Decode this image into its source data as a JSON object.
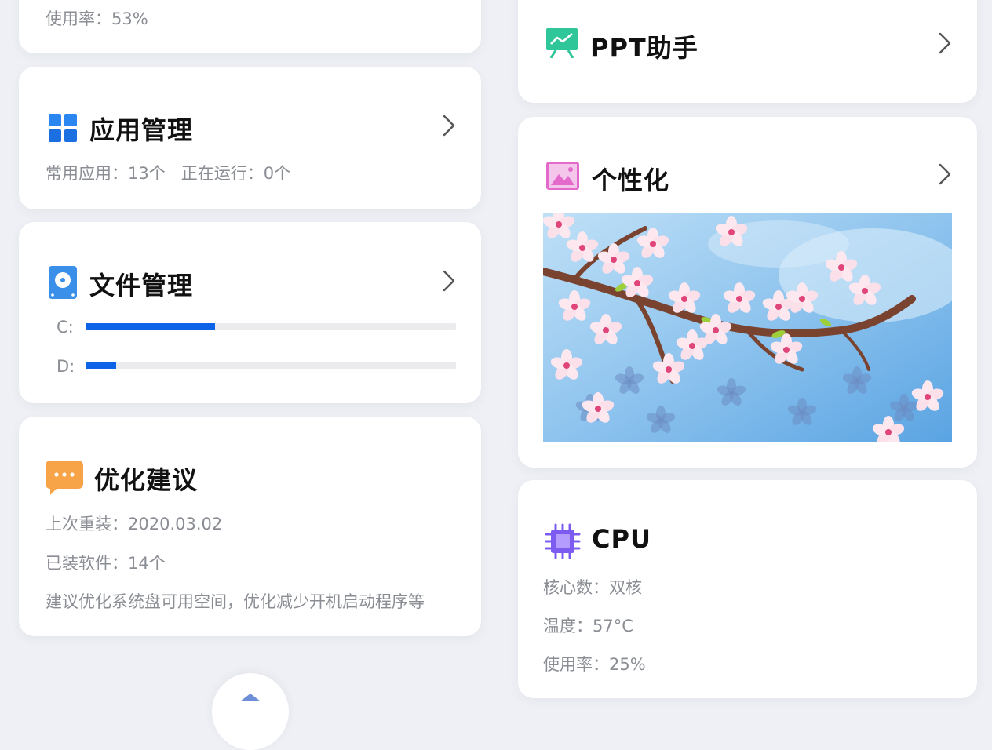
{
  "top_card": {
    "usage": "使用率：53%"
  },
  "app_mgmt": {
    "title": "应用管理",
    "summary": "常用应用：13个   正在运行：0个"
  },
  "file_mgmt": {
    "title": "文件管理",
    "drives": [
      {
        "label": "C:",
        "used_fraction": 0.35
      },
      {
        "label": "D:",
        "used_fraction": 0.083
      }
    ]
  },
  "optimize": {
    "title": "优化建议",
    "last_reinstall": "上次重装：2020.03.02",
    "installed": "已装软件：14个",
    "advice": "建议优化系统盘可用空间，优化减少开机启动程序等"
  },
  "ppt": {
    "title": "PPT助手"
  },
  "personalize": {
    "title": "个性化"
  },
  "cpu": {
    "title": "CPU",
    "cores": "核心数：双核",
    "temp": "温度：57°C",
    "usage": "使用率：25%"
  },
  "colors": {
    "accent_blue": "#0c63e7",
    "ppt_green": "#2fc79a",
    "personalize_pink": "#e36acb",
    "cpu_purple": "#7c5cf0",
    "optimize_orange": "#f7a347"
  }
}
